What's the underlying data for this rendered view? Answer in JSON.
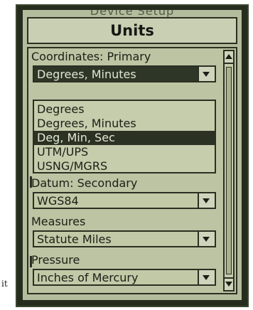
{
  "window": {
    "background_title": "Device Setup",
    "title": "Units"
  },
  "coordinates": {
    "label": "Coordinates: Primary",
    "selected": "Degrees, Minutes",
    "options": [
      "Degrees",
      "Degrees, Minutes",
      "Deg, Min, Sec",
      "UTM/UPS",
      "USNG/MGRS"
    ],
    "highlighted_option": "Deg, Min, Sec"
  },
  "datum": {
    "label": "Datum: Secondary",
    "selected": "WGS84"
  },
  "measures": {
    "label": "Measures",
    "selected": "Statute Miles"
  },
  "pressure": {
    "label": "Pressure",
    "selected": "Inches of Mercury"
  },
  "page_caption": "it",
  "colors": {
    "screen_bg": "#b3bc9c",
    "frame": "#262d1e",
    "highlight": "#2b3224"
  }
}
